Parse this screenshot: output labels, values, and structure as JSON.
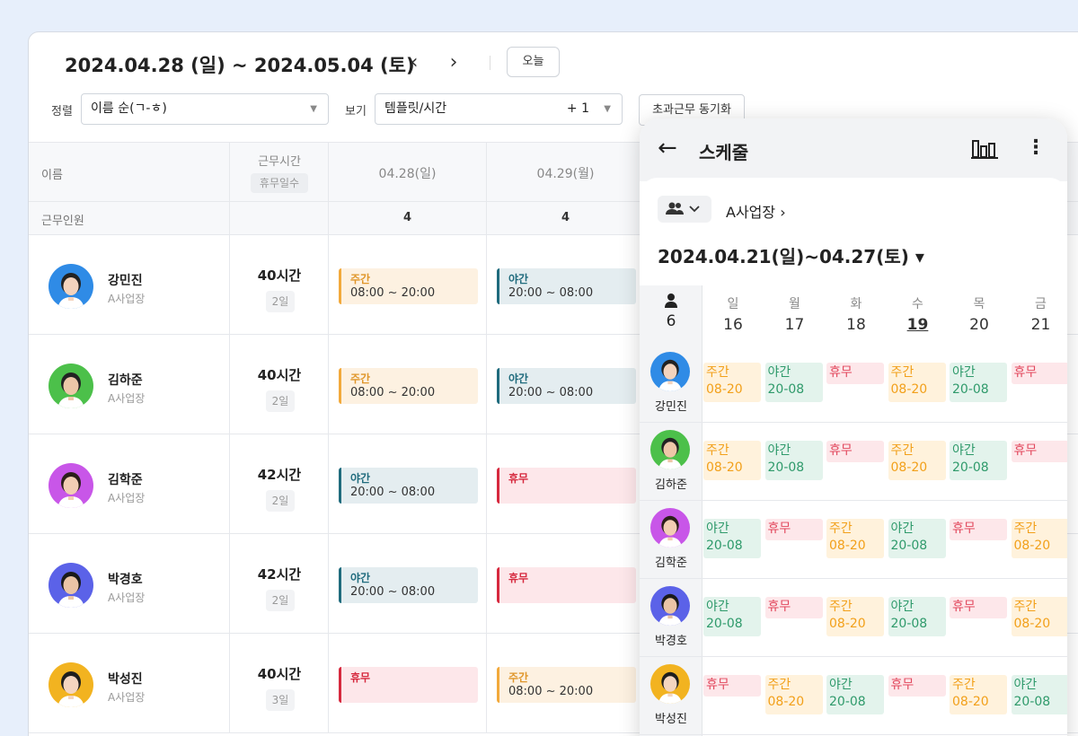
{
  "header": {
    "date_range": "2024.04.28 (일) ~ 2024.05.04 (토)",
    "prev_icon": "‹",
    "next_icon": "›",
    "today_label": "오늘",
    "sort_label": "정렬",
    "sort_value": "이름 순(ㄱ-ㅎ)",
    "view_label": "보기",
    "view_value": "템플릿/시간",
    "view_extra": "+ 1",
    "overtime_sync_label": "초과근무 동기화"
  },
  "table": {
    "col_name": "이름",
    "col_hours": "근무시간",
    "col_days_off": "휴무일수",
    "row_workers": "근무인원",
    "days": [
      "04.28(일)",
      "04.29(월)"
    ],
    "worker_counts": [
      "4",
      "4"
    ],
    "employees": [
      {
        "name": "강민진",
        "workplace": "A사업장",
        "hours": "40시간",
        "days_off": "2일",
        "shifts": [
          {
            "type": "주간",
            "time": "08:00 ~ 20:00"
          },
          {
            "type": "야간",
            "time": "20:00 ~ 08:00"
          }
        ]
      },
      {
        "name": "김하준",
        "workplace": "A사업장",
        "hours": "40시간",
        "days_off": "2일",
        "shifts": [
          {
            "type": "주간",
            "time": "08:00 ~ 20:00"
          },
          {
            "type": "야간",
            "time": "20:00 ~ 08:00"
          }
        ]
      },
      {
        "name": "김학준",
        "workplace": "A사업장",
        "hours": "42시간",
        "days_off": "2일",
        "shifts": [
          {
            "type": "야간",
            "time": "20:00 ~ 08:00"
          },
          {
            "type": "휴무",
            "time": ""
          }
        ]
      },
      {
        "name": "박경호",
        "workplace": "A사업장",
        "hours": "42시간",
        "days_off": "2일",
        "shifts": [
          {
            "type": "야간",
            "time": "20:00 ~ 08:00"
          },
          {
            "type": "휴무",
            "time": ""
          }
        ]
      },
      {
        "name": "박성진",
        "workplace": "A사업장",
        "hours": "40시간",
        "days_off": "3일",
        "shifts": [
          {
            "type": "휴무",
            "time": ""
          },
          {
            "type": "주간",
            "time": "08:00 ~ 20:00"
          }
        ]
      }
    ]
  },
  "panel": {
    "title": "스케줄",
    "back_icon": "←",
    "chart_icon": "bar-chart-icon",
    "more_icon": "⋮",
    "group_icon": "people-icon",
    "site": "A사업장 ›",
    "range": "2024.04.21(일)~04.27(토) ▾",
    "people_count": "6",
    "weekdays": [
      "일",
      "월",
      "화",
      "수",
      "목",
      "금"
    ],
    "dates": [
      "16",
      "17",
      "18",
      "19",
      "20",
      "21"
    ],
    "rows": [
      {
        "name": "강민진",
        "shifts": [
          [
            "주간",
            "08-20"
          ],
          [
            "야간",
            "20-08"
          ],
          [
            "휴무",
            ""
          ],
          [
            "주간",
            "08-20"
          ],
          [
            "야간",
            "20-08"
          ],
          [
            "휴무",
            ""
          ]
        ]
      },
      {
        "name": "김하준",
        "shifts": [
          [
            "주간",
            "08-20"
          ],
          [
            "야간",
            "20-08"
          ],
          [
            "휴무",
            ""
          ],
          [
            "주간",
            "08-20"
          ],
          [
            "야간",
            "20-08"
          ],
          [
            "휴무",
            ""
          ]
        ]
      },
      {
        "name": "김학준",
        "shifts": [
          [
            "야간",
            "20-08"
          ],
          [
            "휴무",
            ""
          ],
          [
            "주간",
            "08-20"
          ],
          [
            "야간",
            "20-08"
          ],
          [
            "휴무",
            ""
          ],
          [
            "주간",
            "08-20"
          ]
        ]
      },
      {
        "name": "박경호",
        "shifts": [
          [
            "야간",
            "20-08"
          ],
          [
            "휴무",
            ""
          ],
          [
            "주간",
            "08-20"
          ],
          [
            "야간",
            "20-08"
          ],
          [
            "휴무",
            ""
          ],
          [
            "주간",
            "08-20"
          ]
        ]
      },
      {
        "name": "박성진",
        "shifts": [
          [
            "휴무",
            ""
          ],
          [
            "주간",
            "08-20"
          ],
          [
            "야간",
            "20-08"
          ],
          [
            "휴무",
            ""
          ],
          [
            "주간",
            "08-20"
          ],
          [
            "야간",
            "20-08"
          ]
        ]
      }
    ]
  },
  "colors": {
    "day_shift": "#f2a93b",
    "night_shift": "#1f6b7d",
    "off_shift": "#d6293e",
    "mobile_day": "#f2a01a",
    "mobile_night": "#2f9a6b",
    "mobile_off": "#e2485d"
  }
}
